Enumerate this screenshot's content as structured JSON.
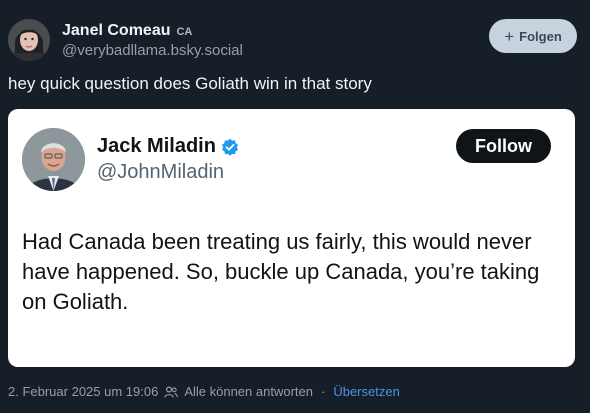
{
  "author": {
    "display_name": "Janel Comeau",
    "flag": "CA",
    "handle": "@verybadllama.bsky.social",
    "avatar_icon": "avatar-woman-photo"
  },
  "follow_button": {
    "label": "Folgen",
    "icon": "plus-icon"
  },
  "post": {
    "text": "hey quick question does Goliath win in that story"
  },
  "embed": {
    "display_name": "Jack Miladin",
    "handle": "@JohnMiladin",
    "follow_label": "Follow",
    "verified": true,
    "text": "Had Canada been treating us fairly, this would never have happened. So, buckle up Canada, you’re taking on Goliath."
  },
  "meta": {
    "timestamp": "2. Februar 2025 um 19:06",
    "reply_setting": "Alle können antworten",
    "translate_label": "Übersetzen"
  },
  "colors": {
    "background": "#161e27",
    "follow_pill": "#c6d2dd",
    "link": "#4d93e8",
    "verified": "#1d9bf0"
  }
}
